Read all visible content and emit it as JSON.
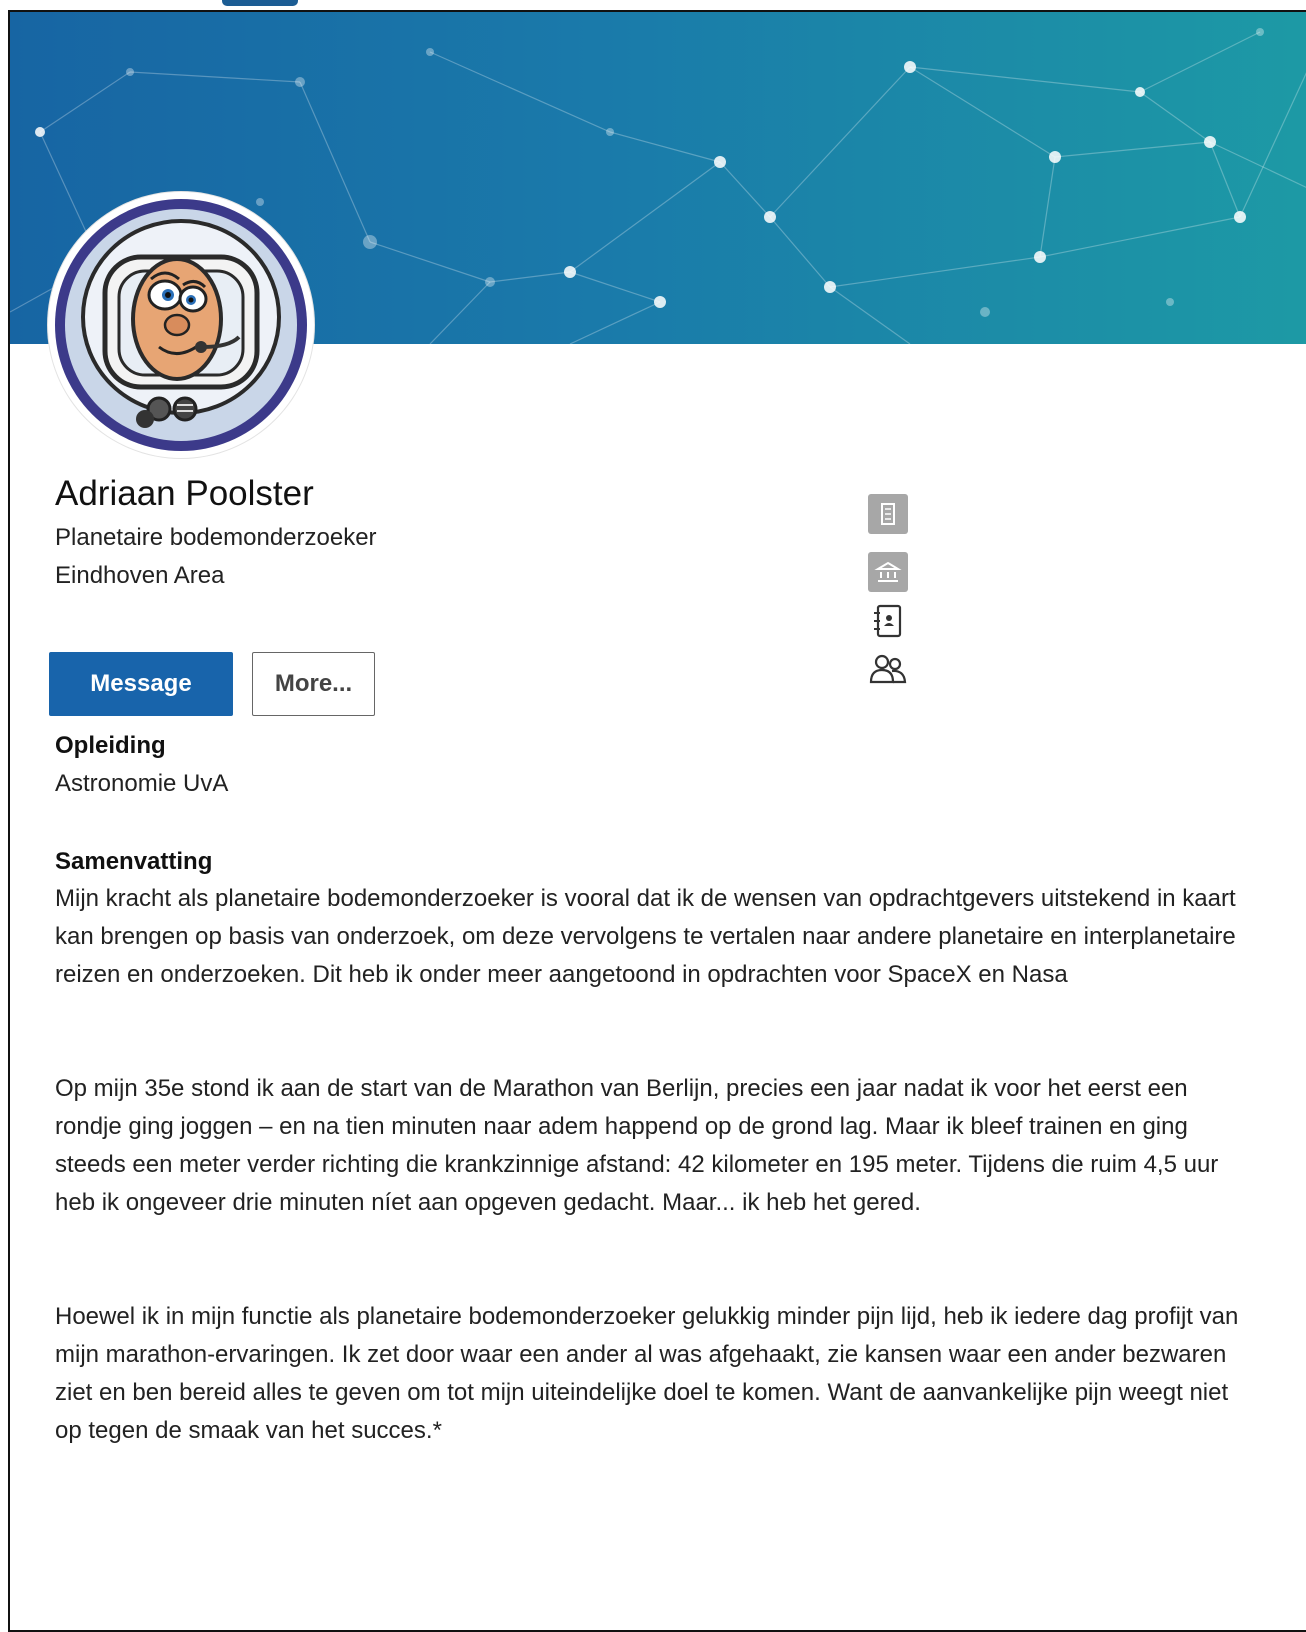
{
  "profile": {
    "name": "Adriaan Poolster",
    "title": "Planetaire bodemonderzoeker",
    "location": "Eindhoven Area"
  },
  "actions": {
    "message_label": "Message",
    "more_label": "More..."
  },
  "side_icons": [
    "building-icon",
    "institution-icon",
    "contact-book-icon",
    "people-icon"
  ],
  "education": {
    "heading": "Opleiding",
    "value": "Astronomie UvA"
  },
  "summary": {
    "heading": "Samenvatting",
    "paragraphs": [
      "Mijn kracht als planetaire bodemonderzoeker is vooral dat ik de wensen van opdrachtgevers uitstekend in kaart kan brengen op basis van onderzoek, om deze vervolgens te vertalen naar andere planetaire en interplanetaire reizen en onderzoeken. Dit heb ik onder meer aangetoond in opdrachten voor SpaceX en Nasa",
      "Op mijn 35e stond ik aan de start van de Marathon van Berlijn, precies een jaar nadat ik voor het eerst een rondje ging joggen – en na tien minuten naar adem happend op de grond lag. Maar ik bleef trainen en ging steeds een meter verder richting die krankzinnige afstand: 42 kilometer en 195 meter. Tijdens die ruim 4,5 uur heb ik ongeveer drie minuten níet aan opgeven gedacht. Maar... ik heb het gered.",
      "Hoewel ik in mijn functie als planetaire bodemonderzoeker gelukkig minder pijn lijd, heb ik iedere dag profijt van mijn marathon-ervaringen. Ik zet door waar een ander al was afgehaakt, zie kansen waar een ander bezwaren ziet en ben bereid alles te geven om tot mijn uiteindelijke doel te komen. Want de aanvankelijke pijn weegt niet op tegen de smaak van het succes.*"
    ]
  },
  "colors": {
    "accent": "#1864ab",
    "banner_start": "#1765a3",
    "banner_end": "#1d9aa5"
  }
}
